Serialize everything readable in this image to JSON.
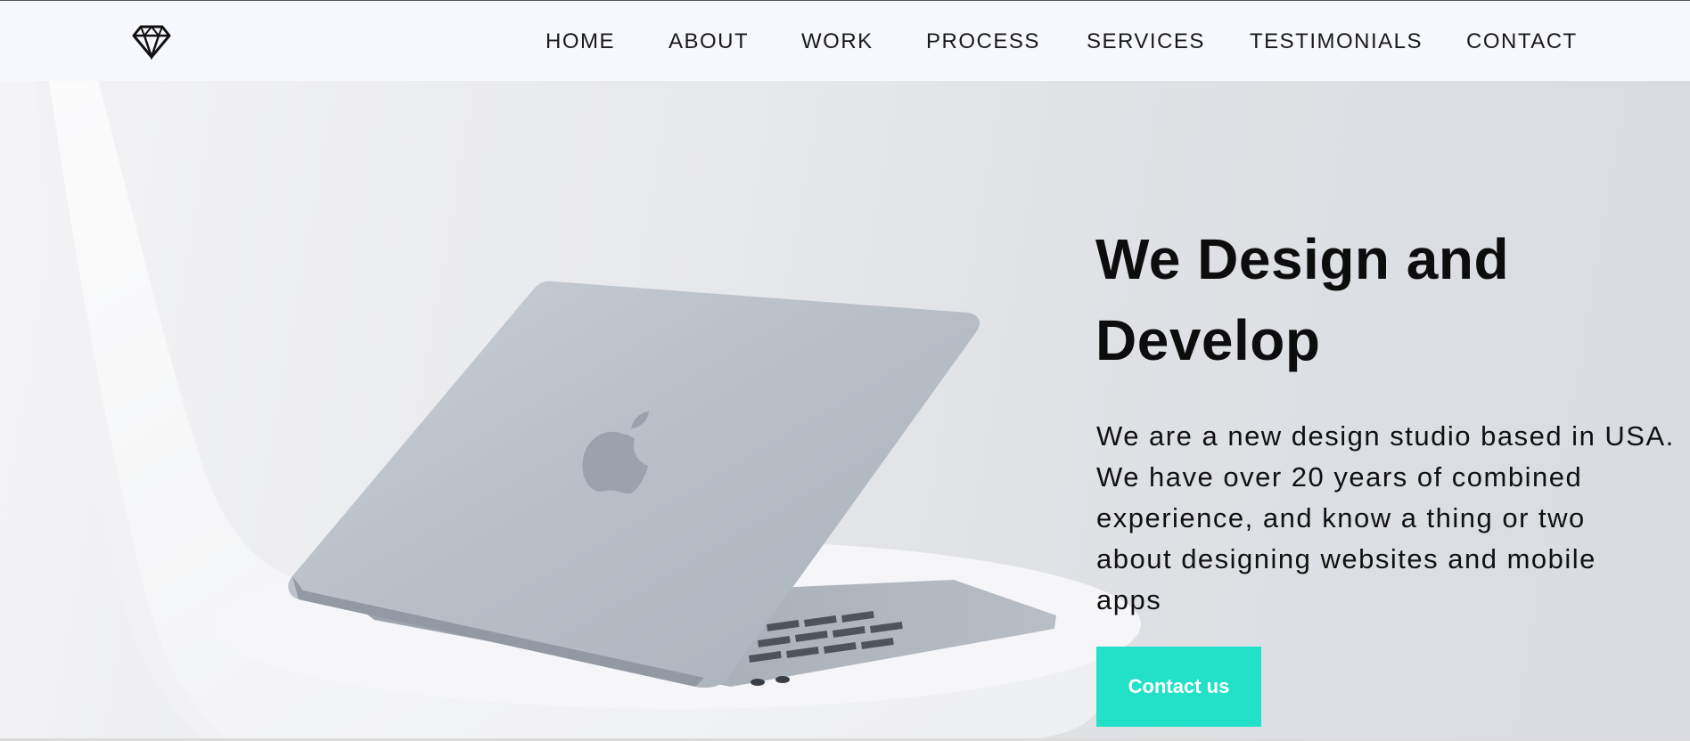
{
  "nav": {
    "logo_icon": "diamond-icon",
    "items": [
      {
        "label": "HOME"
      },
      {
        "label": "ABOUT"
      },
      {
        "label": "WORK"
      },
      {
        "label": "PROCESS"
      },
      {
        "label": "SERVICES"
      },
      {
        "label": "TESTIMONIALS"
      },
      {
        "label": "CONTACT"
      }
    ]
  },
  "hero": {
    "title": "We Design and Develop",
    "text": "We are a new design studio based in USA.\nWe have over 20 years of combined\nexperience, and know a thing or two\nabout designing websites and mobile\napps",
    "cta_label": "Contact us",
    "image": "laptop-on-white-chair",
    "cta_color": "#22e1c8"
  }
}
